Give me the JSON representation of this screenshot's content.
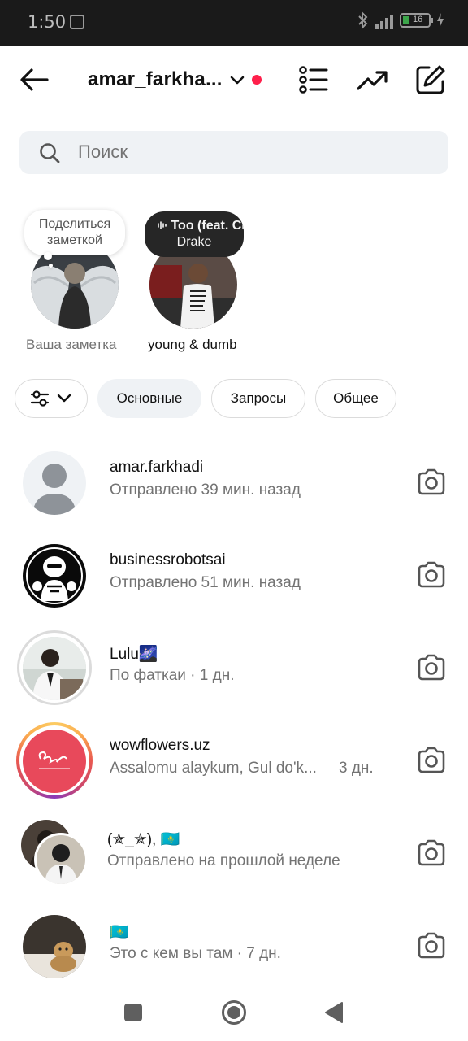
{
  "status_bar": {
    "time": "1:50",
    "battery_text": "16"
  },
  "header": {
    "username": "amar_farkha...",
    "icons": [
      "back-arrow-icon",
      "chevron-down-icon",
      "list-icon",
      "trending-icon",
      "compose-icon"
    ],
    "unread_dot_color": "#ff1f4b"
  },
  "search": {
    "placeholder": "Поиск",
    "value": ""
  },
  "notes": [
    {
      "bubble": "Поделиться заметкой",
      "label": "Ваша заметка"
    },
    {
      "bubble_title": "Too (feat. Cl",
      "bubble_artist": "Drake",
      "label": "young & dumb"
    }
  ],
  "filters": {
    "items": [
      "Основные",
      "Запросы",
      "Общее"
    ],
    "active": "Основные"
  },
  "conversations": [
    {
      "name": "amar.farkhadi",
      "subtitle": "Отправлено 39 мин. назад"
    },
    {
      "name": "businessrobotsai",
      "subtitle": "Отправлено 51 мин. назад"
    },
    {
      "name": "Lulu🌌",
      "subtitle": "По фаткаи · 1 дн."
    },
    {
      "name": "wowflowers.uz",
      "subtitle": "Assalomu alaykum, Gul do'k...",
      "time": "3 дн."
    },
    {
      "name": "(✯_✯), 🇰🇿",
      "subtitle": "Отправлено на прошлой неделе"
    },
    {
      "name": "🇰🇿",
      "subtitle": "Это с кем вы там · 7 дн."
    }
  ],
  "navbar": {
    "icons": [
      "recents-square-icon",
      "home-circle-icon",
      "back-triangle-icon"
    ]
  }
}
